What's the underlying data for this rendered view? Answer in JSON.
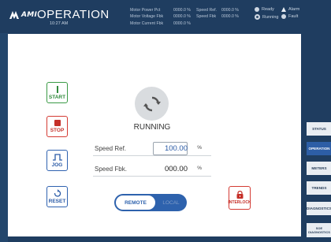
{
  "header": {
    "logo_text": "AMI",
    "title": "OPERATION",
    "time": "10:27 AM",
    "status_rows": [
      {
        "label": "Motor Power Pct",
        "value": "0000.0 %",
        "label2": "Speed Ref.",
        "value2": "0000.0 %"
      },
      {
        "label": "Motor Voltage Fbk",
        "value": "0000.0 %",
        "label2": "Speed Fbk",
        "value2": "0000.0 %"
      },
      {
        "label": "Motor Current Fbk",
        "value": "0000.0 %",
        "label2": "",
        "value2": ""
      }
    ],
    "indicators": {
      "ready": "Ready",
      "running": "Running",
      "alarm": "Alarm",
      "fault": "Fault"
    }
  },
  "controls": {
    "start_label": "START",
    "stop_label": "STOP",
    "jog_label": "JOG",
    "reset_label": "RESET",
    "interlock_label": "INTERLOCK"
  },
  "state": {
    "label": "RUNNING"
  },
  "fields": {
    "speed_ref_label": "Speed Ref.",
    "speed_ref_value": "100.00",
    "speed_ref_unit": "%",
    "speed_fbk_label": "Speed Fbk.",
    "speed_fbk_value": "000.00",
    "speed_fbk_unit": "%"
  },
  "mode_toggle": {
    "on_label": "REMOTE",
    "off_label": "LOCAL"
  },
  "nav": {
    "items": [
      "STATUS",
      "OPERATION",
      "METERS",
      "TRENDS",
      "DIAGNOSTICS",
      "SOE DIAGNOSTICS"
    ],
    "active": "OPERATION"
  },
  "colors": {
    "header_bg": "#1f3d60",
    "start": "#3a9a45",
    "stop": "#d43a33",
    "primary": "#2e62ad"
  }
}
